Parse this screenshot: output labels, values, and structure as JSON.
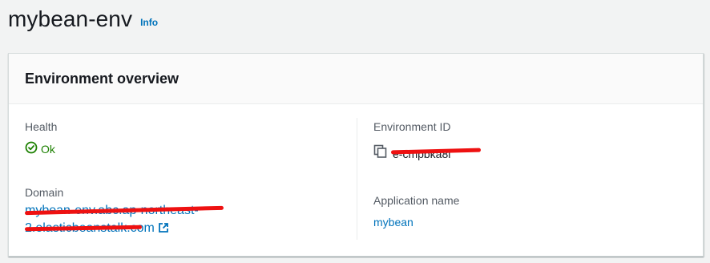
{
  "page": {
    "title": "mybean-env",
    "info_label": "Info"
  },
  "overview": {
    "title": "Environment overview",
    "health": {
      "label": "Health",
      "value": "Ok"
    },
    "domain": {
      "label": "Domain",
      "value": "mybean-env.abc.ap-northeast-2.elasticbeanstalk.com"
    },
    "environment_id": {
      "label": "Environment ID",
      "value": "e-cmpbka8l"
    },
    "application_name": {
      "label": "Application name",
      "value": "mybean"
    }
  },
  "colors": {
    "link": "#0073bb",
    "success": "#1d8102",
    "redaction": "#ee1111"
  },
  "icons": [
    "status-ok-icon",
    "copy-icon",
    "external-link-icon"
  ]
}
